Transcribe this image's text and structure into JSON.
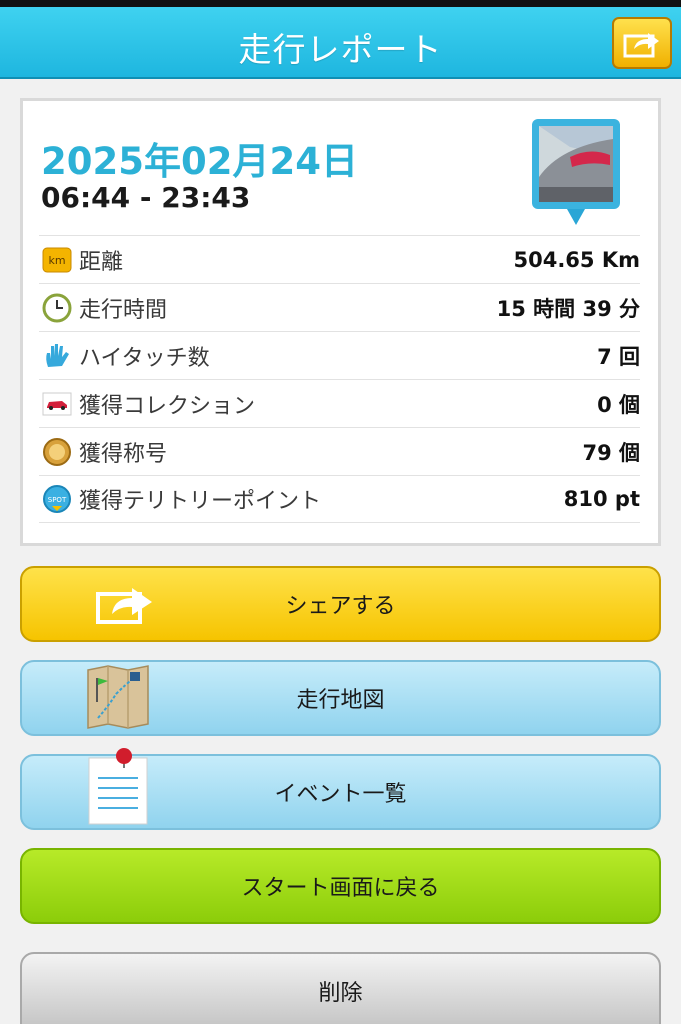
{
  "header": {
    "title": "走行レポート",
    "share_icon": "share-arrow-icon"
  },
  "report": {
    "date": "2025年02月24日",
    "time_range": "06:44 - 23:43",
    "rows": [
      {
        "icon": "km-icon",
        "label": "距離",
        "value": "504.65 Km"
      },
      {
        "icon": "clock-icon",
        "label": "走行時間",
        "value": "15 時間 39 分"
      },
      {
        "icon": "hand-icon",
        "label": "ハイタッチ数",
        "value": "7 回"
      },
      {
        "icon": "car-icon",
        "label": "獲得コレクション",
        "value": "0 個"
      },
      {
        "icon": "medal-icon",
        "label": "獲得称号",
        "value": "79 個"
      },
      {
        "icon": "spot-icon",
        "label": "獲得テリトリーポイント",
        "value": "810 pt"
      }
    ],
    "km_badge": "km",
    "spot_badge": "SPOT"
  },
  "buttons": {
    "share": "シェアする",
    "map": "走行地図",
    "events": "イベント一覧",
    "back_to_start": "スタート画面に戻る",
    "delete": "削除"
  },
  "colors": {
    "header": "#1eb6df",
    "date": "#2cb1d6",
    "share_button": "#f6c400",
    "blue_button": "#90d3ee",
    "green_button": "#8ccd0a",
    "gray_button": "#bdbdbd"
  }
}
